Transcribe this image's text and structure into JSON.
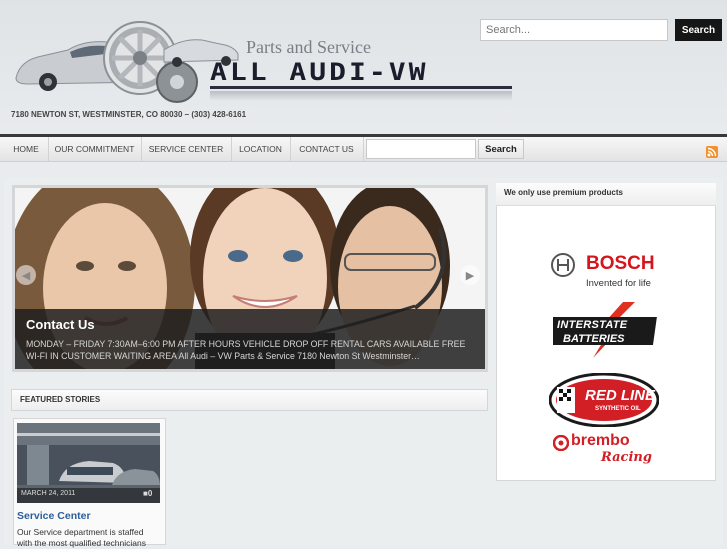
{
  "header": {
    "tagline": "Parts and Service",
    "brand": "ALL AUDI-VW",
    "address": "7180 NEWTON ST, WESTMINSTER, CO 80030 – (303) 428-6161",
    "search_placeholder": "Search...",
    "search_button": "Search"
  },
  "nav": {
    "items": [
      "HOME",
      "OUR COMMITMENT",
      "SERVICE CENTER",
      "LOCATION",
      "CONTACT US"
    ],
    "search_button": "Search",
    "search_placeholder": ""
  },
  "slider": {
    "title": "Contact Us",
    "text": "MONDAY – FRIDAY 7:30AM–6:00 PM AFTER HOURS VEHICLE DROP OFF RENTAL CARS AVAILABLE FREE WI-FI IN CUSTOMER WAITING AREA All Audi – VW Parts & Service 7180 Newton St Westminster…",
    "prev_icon": "chevron-left-icon",
    "next_icon": "chevron-right-icon"
  },
  "featured": {
    "label": "FEATURED STORIES",
    "card": {
      "date": "MARCH 24, 2011",
      "comments": "0",
      "title": "Service Center",
      "text": "Our Service department is staffed with the most qualified technicians"
    }
  },
  "sidebar": {
    "title": "We only use premium products",
    "brands": [
      {
        "name": "BOSCH",
        "sub": "Invented for life"
      },
      {
        "name": "INTERSTATE",
        "sub": "BATTERIES"
      },
      {
        "name": "RED LINE",
        "sub": "SYNTHETIC OIL"
      },
      {
        "name": "brembo",
        "sub": "Racing"
      }
    ]
  },
  "colors": {
    "nav_border": "#3a3a3a",
    "link_blue": "#2b5e9a",
    "bosch_red": "#d6141c",
    "rss_orange": "#f2912e"
  }
}
